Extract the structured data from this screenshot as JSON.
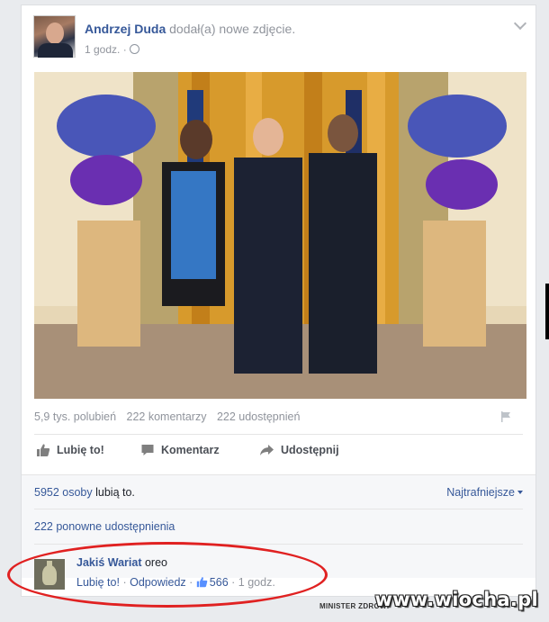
{
  "post": {
    "author": "Andrzej Duda",
    "action_text": "dodał(a) nowe zdjęcie.",
    "time": "1 godz.",
    "separator": "·",
    "privacy_icon": "globe-icon",
    "menu_icon": "chevron-down-icon"
  },
  "stats": {
    "likes": "5,9 tys. polubień",
    "comments": "222 komentarzy",
    "shares": "222 udostępnień"
  },
  "actions": {
    "like": "Lubię to!",
    "comment": "Komentarz",
    "share": "Udostępnij"
  },
  "summary": {
    "likes_count": "5952 osoby",
    "likes_suffix": "lubią to.",
    "sort_label": "Najtrafniejsze",
    "reshares": "222 ponowne udostępnienia"
  },
  "comment": {
    "author": "Jakiś Wariat",
    "text": "oreo",
    "like_label": "Lubię to!",
    "reply_label": "Odpowiedz",
    "like_count": "566",
    "time": "1 godz."
  },
  "overlay": {
    "watermark": "www.wiocha.pl",
    "small_caption": "MINISTER ZDROWI",
    "highlight_color": "#e02121"
  },
  "colors": {
    "link": "#365899",
    "muted": "#90949c",
    "background": "#e9ebee"
  }
}
